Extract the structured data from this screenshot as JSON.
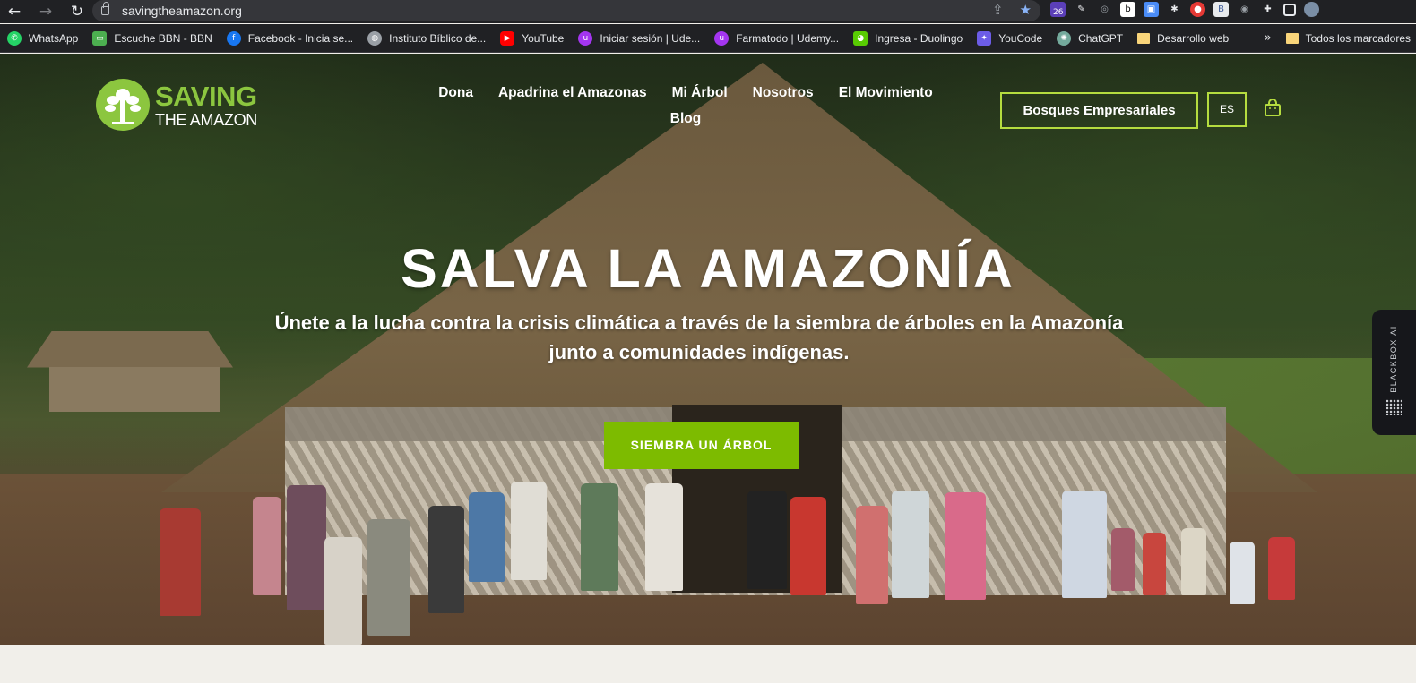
{
  "browser": {
    "url": "savingtheamazon.org",
    "extension_badge": "26",
    "bookmarks": [
      {
        "label": "WhatsApp",
        "icon": "whatsapp-icon",
        "color": "#25d366"
      },
      {
        "label": "Escuche BBN - BBN",
        "icon": "radio-icon",
        "color": "#4caf50"
      },
      {
        "label": "Facebook - Inicia se...",
        "icon": "facebook-icon",
        "color": "#1877f2"
      },
      {
        "label": "Instituto Bíblico de...",
        "icon": "globe-icon",
        "color": "#9aa0a6"
      },
      {
        "label": "YouTube",
        "icon": "youtube-icon",
        "color": "#ff0000"
      },
      {
        "label": "Iniciar sesión | Ude...",
        "icon": "udemy-icon",
        "color": "#a435f0"
      },
      {
        "label": "Farmatodo | Udemy...",
        "icon": "udemy-icon",
        "color": "#a435f0"
      },
      {
        "label": "Ingresa - Duolingo",
        "icon": "duolingo-icon",
        "color": "#58cc02"
      },
      {
        "label": "YouCode",
        "icon": "youcode-icon",
        "color": "#6c5ce7"
      },
      {
        "label": "ChatGPT",
        "icon": "chatgpt-icon",
        "color": "#74aa9c"
      },
      {
        "label": "Desarrollo web",
        "icon": "folder-icon",
        "color": "#f9d57a"
      }
    ],
    "more_label": "»",
    "all_bookmarks": "Todos los marcadores"
  },
  "site": {
    "logo": {
      "line1": "SAVING",
      "line2": "THE AMAZON"
    },
    "menu": [
      "Dona",
      "Apadrina el Amazonas",
      "Mi Árbol",
      "Nosotros",
      "El Movimiento",
      "Blog"
    ],
    "corporate_button": "Bosques Empresariales",
    "language": "ES",
    "accent": "#8cc63f"
  },
  "hero": {
    "title": "SALVA LA AMAZONÍA",
    "subtitle": "Únete a la lucha contra la crisis climática a través de la siembra de árboles en la Amazonía junto a comunidades indígenas.",
    "cta": "SIEMBRA UN ÁRBOL",
    "cta_color": "#7dbb00"
  },
  "sidebar_widget": {
    "label": "BLACKBOX AI"
  }
}
